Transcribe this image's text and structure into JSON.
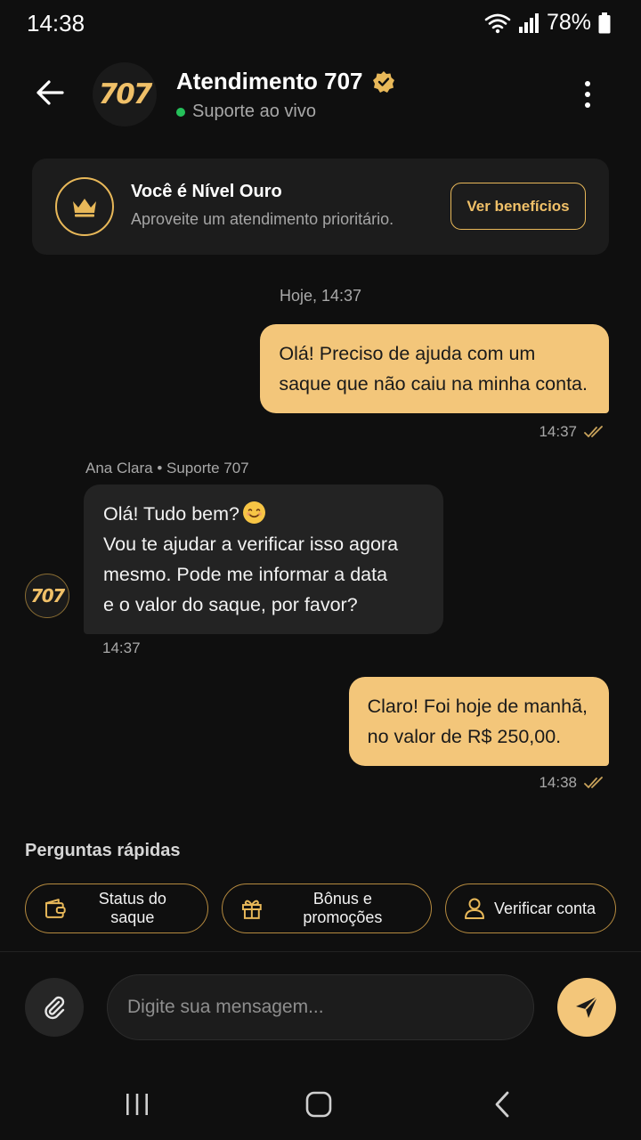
{
  "status_bar": {
    "time": "14:38",
    "battery_pct": "78%"
  },
  "header": {
    "avatar_logo": "707",
    "title": "Atendimento 707",
    "status": "Suporte ao vivo",
    "verified_color": "#e8b859",
    "online_color": "#25c05a"
  },
  "vip_card": {
    "title": "Você é Nível Ouro",
    "subtitle": "Aproveite um atendimento prioritário.",
    "button": "Ver benefícios"
  },
  "chat": {
    "day_label": "Hoje, 14:37",
    "messages": [
      {
        "from": "user",
        "lines": [
          "Olá! Preciso de ajuda com um",
          "saque que não caiu na minha conta."
        ],
        "time": "14:37",
        "read": true
      },
      {
        "from": "agent",
        "sender": "Ana Clara • Suporte 707",
        "avatar_logo": "707",
        "lines": [
          "Olá! Tudo bem?",
          "Vou te ajudar a verificar isso agora",
          "mesmo. Pode me informar a data",
          "e o valor do saque, por favor?"
        ],
        "emoji": "smiling-face",
        "time": "14:37"
      },
      {
        "from": "user",
        "lines": [
          "Claro! Foi hoje de manhã,",
          "no valor de R$ 250,00."
        ],
        "time": "14:38",
        "read": true
      }
    ]
  },
  "quick_replies": {
    "title": "Perguntas rápidas",
    "chips": [
      {
        "label": "Status do saque",
        "icon": "wallet-icon"
      },
      {
        "label": "Bônus e promoções",
        "icon": "gift-icon"
      },
      {
        "label": "Verificar conta",
        "icon": "user-icon"
      }
    ]
  },
  "composer": {
    "placeholder": "Digite sua mensagem..."
  },
  "theme": {
    "accent": "#f3c67a",
    "background": "#0f0f0f",
    "bubble_in": "#232323"
  }
}
